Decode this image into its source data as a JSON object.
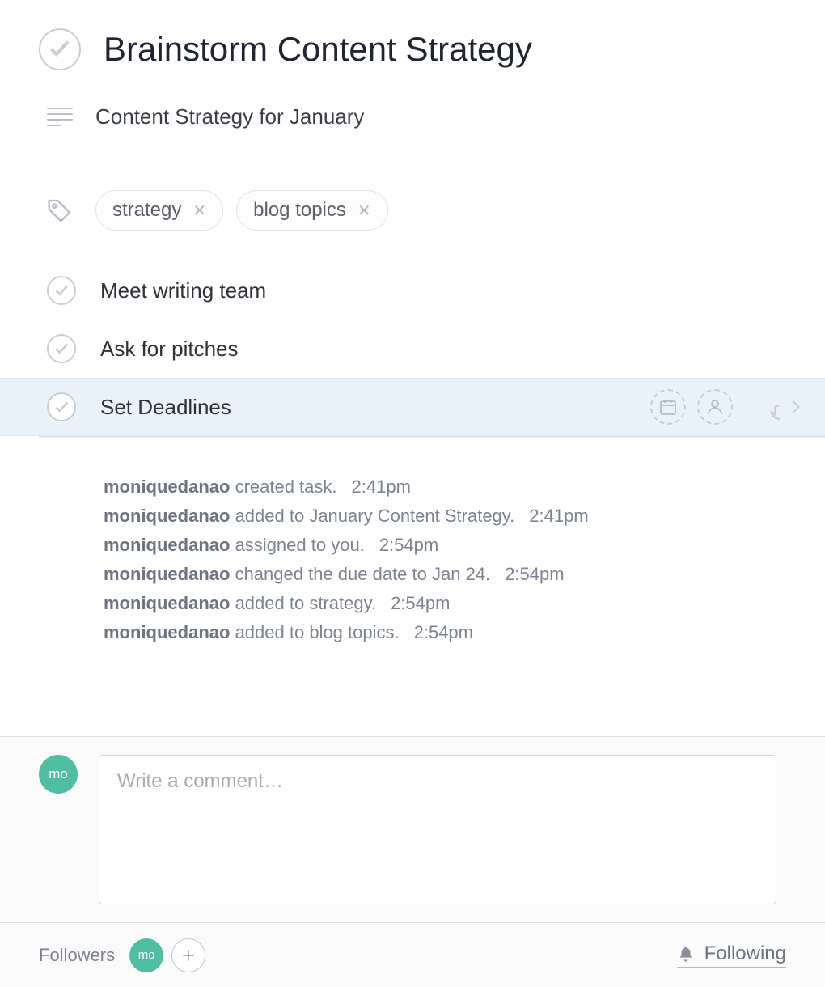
{
  "title": "Brainstorm Content Strategy",
  "project_name": "Content Strategy for January",
  "tags": [
    {
      "label": "strategy"
    },
    {
      "label": "blog topics"
    }
  ],
  "subtasks": {
    "items": [
      {
        "label": "Meet writing team",
        "selected": false
      },
      {
        "label": "Ask for pitches",
        "selected": false
      },
      {
        "label": "Set Deadlines",
        "selected": true
      }
    ]
  },
  "activity": [
    {
      "user": "moniquedanao",
      "action": "created task.",
      "time": "2:41pm"
    },
    {
      "user": "moniquedanao",
      "action": "added to January Content Strategy.",
      "time": "2:41pm"
    },
    {
      "user": "moniquedanao",
      "action": "assigned to you.",
      "time": "2:54pm"
    },
    {
      "user": "moniquedanao",
      "action": "changed the due date to Jan 24.",
      "time": "2:54pm"
    },
    {
      "user": "moniquedanao",
      "action": "added to strategy.",
      "time": "2:54pm"
    },
    {
      "user": "moniquedanao",
      "action": "added to blog topics.",
      "time": "2:54pm"
    }
  ],
  "comment": {
    "avatar_initials": "mo",
    "placeholder": "Write a comment…"
  },
  "followers": {
    "label": "Followers",
    "avatars": [
      "mo"
    ],
    "following_label": "Following"
  },
  "icons": {
    "check": "check-icon",
    "lines": "description-lines-icon",
    "tag": "tag-icon",
    "calendar": "calendar-icon",
    "person": "person-icon",
    "speech": "speech-bubble-icon",
    "chevron_right": "chevron-right-icon",
    "bell": "bell-icon",
    "plus": "plus-icon",
    "x": "close-x-icon"
  }
}
